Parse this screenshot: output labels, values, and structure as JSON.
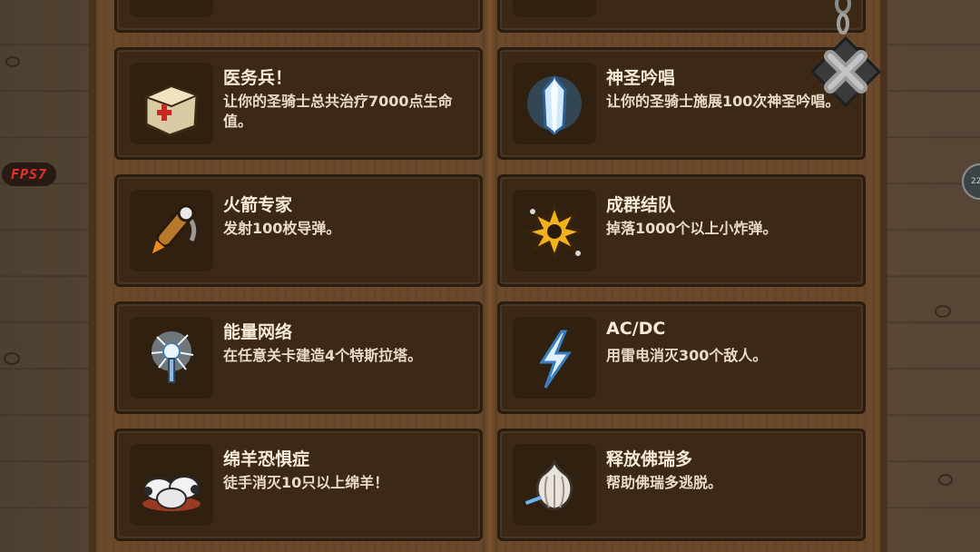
{
  "hud": {
    "fps_label": "FPS7",
    "side_button_label": "22"
  },
  "achievements": [
    {
      "title": "",
      "description": "",
      "icon": "partial-icon-top-left"
    },
    {
      "title": "",
      "description": "",
      "icon": "partial-icon-top-right"
    },
    {
      "title": "医务兵！",
      "description": "让你的圣骑士总共治疗7000点生命值。",
      "icon": "medkit-icon"
    },
    {
      "title": "神圣吟唱",
      "description": "让你的圣骑士施展100次神圣吟唱。",
      "icon": "holy-crystal-icon"
    },
    {
      "title": "火箭专家",
      "description": "发射100枚导弹。",
      "icon": "rocket-icon"
    },
    {
      "title": "成群结队",
      "description": "掉落1000个以上小炸弹。",
      "icon": "explosion-icon"
    },
    {
      "title": "能量网络",
      "description": "在任意关卡建造4个特斯拉塔。",
      "icon": "tesla-coil-icon"
    },
    {
      "title": "AC/DC",
      "description": "用雷电消灭300个敌人。",
      "icon": "lightning-icon"
    },
    {
      "title": "绵羊恐惧症",
      "description": "徒手消灭10只以上绵羊！",
      "icon": "sheep-icon"
    },
    {
      "title": "释放佛瑞多",
      "description": "帮助佛瑞多逃脱。",
      "icon": "garlic-icon"
    }
  ],
  "colors": {
    "card_bg": "#3b2916",
    "panel_wood": "#6b4a2c",
    "title_text": "#f5ead8",
    "fps_text": "#e2332b"
  }
}
